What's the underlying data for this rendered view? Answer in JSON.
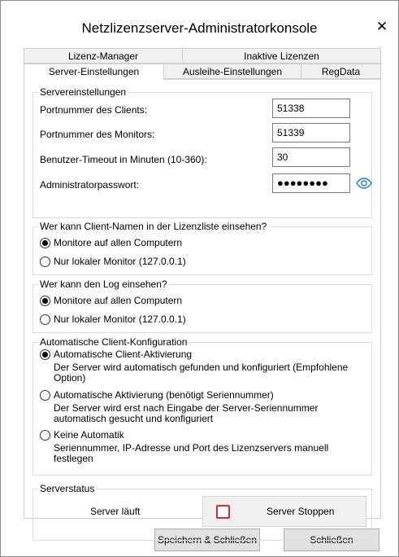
{
  "window": {
    "title": "Netzlizenzserver-Administratorkonsole",
    "close_glyph": "✕"
  },
  "tabs": {
    "row1": [
      "Lizenz-Manager",
      "Inaktive Lizenzen"
    ],
    "row2": [
      "Server-Einstellungen",
      "Ausleihe-Einstellungen",
      "RegData"
    ],
    "active": "Server-Einstellungen"
  },
  "server_settings": {
    "legend": "Servereinstellungen",
    "client_port_label": "Portnummer des Clients:",
    "client_port_value": "51338",
    "monitor_port_label": "Portnummer des Monitors:",
    "monitor_port_value": "51339",
    "timeout_label": "Benutzer-Timeout in Minuten (10-360):",
    "timeout_value": "30",
    "password_label": "Administratorpasswort:",
    "password_value": "●●●●●●●●",
    "show_password_icon": "eye-icon"
  },
  "client_names_group": {
    "legend": "Wer kann Client-Namen in der Lizenzliste einsehen?",
    "option_all": "Monitore auf allen Computern",
    "option_local": "Nur lokaler Monitor (127.0.0.1)",
    "selected": "option_all"
  },
  "log_group": {
    "legend": "Wer kann den Log einsehen?",
    "option_all": "Monitore auf allen Computern",
    "option_local": "Nur lokaler Monitor (127.0.0.1)",
    "selected": "option_all"
  },
  "auto_config_group": {
    "legend": "Automatische Client-Konfiguration",
    "option1_label": "Automatische Client-Aktivierung",
    "option1_desc": "Der Server wird automatisch gefunden und konfiguriert (Empfohlene Option)",
    "option2_label": "Automatische Aktivierung (benötigt Seriennummer)",
    "option2_desc": "Der Server wird erst nach Eingabe der Server-Seriennummer automatisch gesucht und konfiguriert",
    "option3_label": "Keine Automatik",
    "option3_desc": "Seriennummer, IP-Adresse und Port des Lizenzservers manuell festlegen",
    "selected": "option1"
  },
  "server_status": {
    "legend": "Serverstatus",
    "status_text": "Server läuft",
    "stop_button_label": "Server Stoppen",
    "stop_icon_color": "#d92b2b"
  },
  "footer": {
    "save_close_label": "Speichern & Schließen",
    "close_label": "Schließen"
  }
}
